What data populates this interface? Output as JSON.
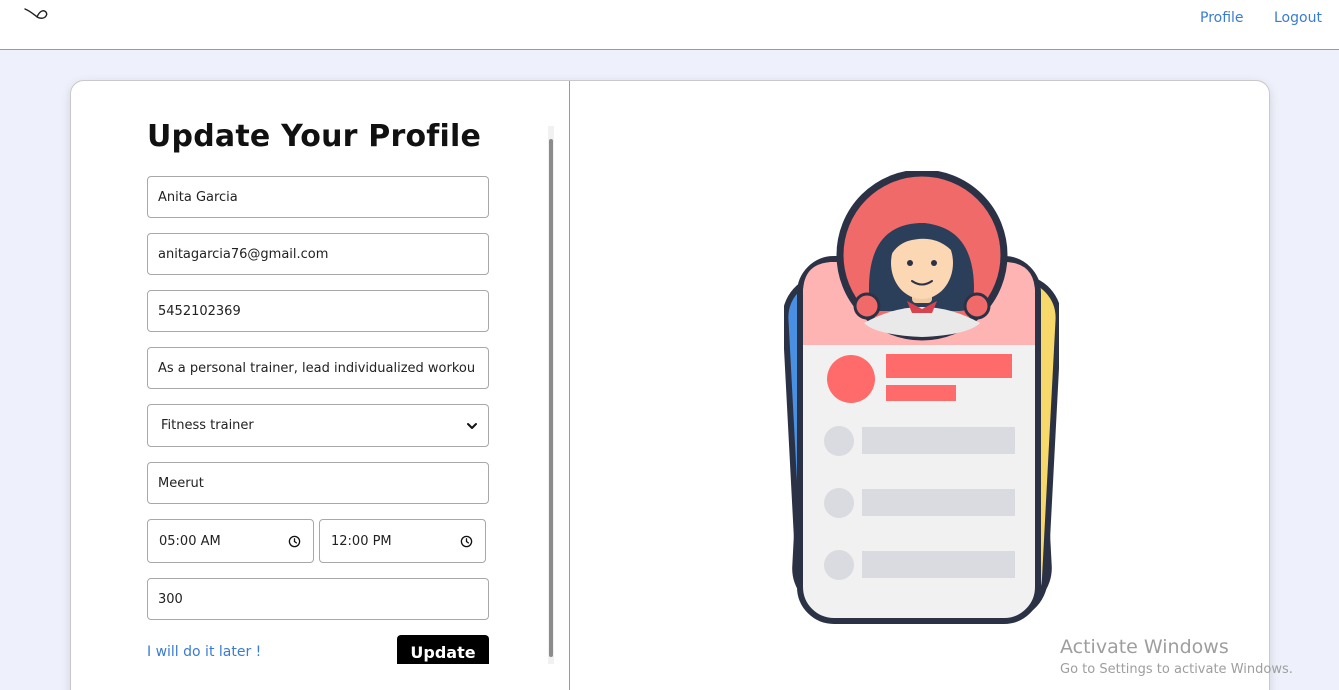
{
  "nav": {
    "logo_icon": "infinity-loop-logo",
    "profile_label": "Profile",
    "logout_label": "Logout"
  },
  "form": {
    "title": "Update Your Profile",
    "name": "Anita Garcia",
    "email": "anitagarcia76@gmail.com",
    "phone": "5452102369",
    "bio": "As a personal trainer, lead individualized workou",
    "role": "Fitness trainer",
    "city": "Meerut",
    "start_time": "05:00 AM",
    "end_time": "12:00 PM",
    "price": "300",
    "later_label": "I will do it later !",
    "submit_label": "Update"
  },
  "illustration": {
    "icon": "profile-card-illustration"
  },
  "watermark": {
    "title": "Activate Windows",
    "subtitle": "Go to Settings to activate Windows."
  },
  "colors": {
    "accent": "#3a7bd5",
    "button": "#000000",
    "card_pink": "#ffb4b4",
    "avatar_red": "#f06a6a"
  }
}
